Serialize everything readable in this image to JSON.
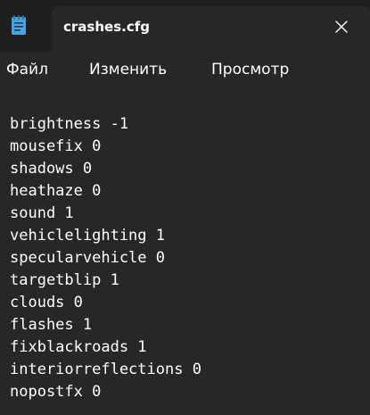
{
  "window": {
    "tab_title": "crashes.cfg",
    "app_icon": "notepad-icon",
    "close_icon": "close-icon"
  },
  "menu": {
    "items": [
      "Файл",
      "Изменить",
      "Просмотр"
    ]
  },
  "editor": {
    "lines": [
      "brightness -1",
      "mousefix 0",
      "shadows 0",
      "heathaze 0",
      "sound 1",
      "vehiclelighting 1",
      "specularvehicle 0",
      "targetblip 1",
      "clouds 0",
      "flashes 1",
      "fixblackroads 1",
      "interiorreflections 0",
      "nopostfx 0"
    ]
  },
  "colors": {
    "background": "#272727",
    "titlebar": "#1f1f1f",
    "icon_blue": "#4aa3df",
    "text": "#ffffff"
  }
}
